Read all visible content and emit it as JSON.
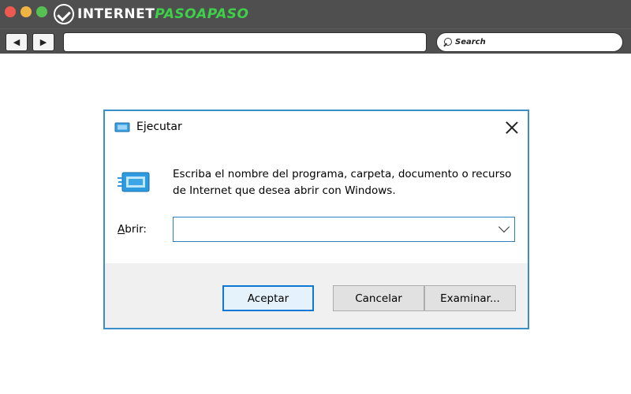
{
  "browser": {
    "brand_main": "INTERNET",
    "brand_accent": "PASOAPASO",
    "nav_back_glyph": "◀",
    "nav_forward_glyph": "▶",
    "url_value": "",
    "search_placeholder": "Search",
    "traffic_colors": [
      "#ee5a4f",
      "#f0b445",
      "#56c152"
    ]
  },
  "dialog": {
    "title": "Ejecutar",
    "description": "Escriba el nombre del programa, carpeta, documento o recurso de Internet que desea abrir con Windows.",
    "open_label_mnemonic": "A",
    "open_label_rest": "brir:",
    "open_value": "",
    "buttons": {
      "ok": "Aceptar",
      "cancel": "Cancelar",
      "browse": "Examinar..."
    },
    "accent_color": "#3b8fc9"
  }
}
